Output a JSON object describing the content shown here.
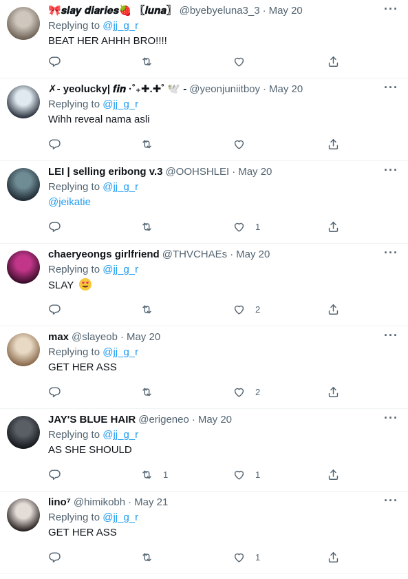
{
  "tweets": [
    {
      "name": "🎀𝒔𝒍𝒂𝒚 𝒅𝒊𝒂𝒓𝒊𝒆𝒔🍓 〖𝒍𝒖𝒏𝒂〗",
      "handle": "@byebyeluna3_3",
      "sep": "·",
      "date": "May 20",
      "replying_prefix": "Replying to",
      "replying_to": "@jj_g_r",
      "text": "BEAT HER AHHH BRO!!!!",
      "replies": "",
      "retweets": "",
      "likes": "",
      "avatar_colors": [
        "#cfc7bd",
        "#6e6256"
      ]
    },
    {
      "name": "✗- yeolucky| 𝒇𝒊𝒏 ·˚₊✚.✚˚ 🕊️ -",
      "handle": "@yeonjuniitboy",
      "sep": "·",
      "date": "May 20",
      "replying_prefix": "Replying to",
      "replying_to": "@jj_g_r",
      "text": "Wihh reveal nama asli",
      "replies": "",
      "retweets": "",
      "likes": "",
      "avatar_colors": [
        "#dfe9ef",
        "#2d3440"
      ]
    },
    {
      "name": "LEI | selling eribong v.3",
      "handle": "@OOHSHLEI",
      "sep": "·",
      "date": "May 20",
      "replying_prefix": "Replying to",
      "replying_to": "@jj_g_r",
      "text": "@jeikatie",
      "text_is_link": true,
      "replies": "",
      "retweets": "",
      "likes": "1",
      "avatar_colors": [
        "#6f8c95",
        "#1f2a33"
      ]
    },
    {
      "name": "chaeryeongs girlfriend",
      "handle": "@THVCHAEs",
      "sep": "·",
      "date": "May 20",
      "replying_prefix": "Replying to",
      "replying_to": "@jj_g_r",
      "text": "SLAY",
      "emoji": "smiling-face-heart-eyes",
      "replies": "",
      "retweets": "",
      "likes": "2",
      "avatar_colors": [
        "#c2368a",
        "#3a0d2a"
      ]
    },
    {
      "name": "max",
      "handle": "@slayeob",
      "sep": "·",
      "date": "May 20",
      "replying_prefix": "Replying to",
      "replying_to": "@jj_g_r",
      "text": "GET HER ASS",
      "replies": "",
      "retweets": "",
      "likes": "2",
      "avatar_colors": [
        "#e8d9c4",
        "#8a6a4c"
      ]
    },
    {
      "name": "JAY'S BLUE HAIR",
      "handle": "@erigeneo",
      "sep": "·",
      "date": "May 20",
      "replying_prefix": "Replying to",
      "replying_to": "@jj_g_r",
      "text": "AS SHE SHOULD",
      "replies": "",
      "retweets": "1",
      "likes": "1",
      "avatar_colors": [
        "#5a5f66",
        "#15181c"
      ]
    },
    {
      "name": "lino⁷",
      "handle": "@himikobh",
      "sep": "·",
      "date": "May 21",
      "replying_prefix": "Replying to",
      "replying_to": "@jj_g_r",
      "text": "GET HER ASS",
      "replies": "",
      "retweets": "",
      "likes": "1",
      "avatar_colors": [
        "#e4dcd7",
        "#2a2422"
      ]
    }
  ],
  "icons": {
    "reply": "reply-icon",
    "retweet": "retweet-icon",
    "like": "heart-icon",
    "share": "share-icon",
    "more": "more-options-icon"
  },
  "colors": {
    "accent": "#1d9bf0",
    "secondary_text": "#536471",
    "primary_text": "#0f1419",
    "divider": "#eff3f4"
  }
}
